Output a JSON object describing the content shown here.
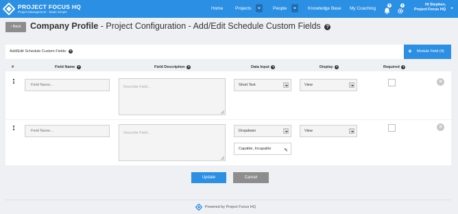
{
  "brand": {
    "name": "PROJECT FOCUS HQ",
    "tagline": "Project Management - Made Simple",
    "accent": "#2b8fe3"
  },
  "nav": {
    "home": "Home",
    "projects": "Projects",
    "people": "People",
    "knowledge_base": "Knowledge Base",
    "my_coaching": "My Coaching",
    "notifications_count": "2",
    "settings_count": "1",
    "user_greeting": "Hi Stephen,",
    "user_company": "Project Focus HQ"
  },
  "page": {
    "back_label": "Back",
    "title_bold": "Company Profile",
    "title_rest": " - Project Configuration - Add/Edit Schedule Custom Fields",
    "help_glyph": "?"
  },
  "panel": {
    "label": "Add/Edit Schedule Custom Fields:",
    "module_field_button": "Module Field (4)"
  },
  "columns": {
    "hash": "#",
    "field_name": "Field Name",
    "field_description": "Field Description",
    "data_input": "Data Input",
    "display": "Display",
    "required": "Required"
  },
  "rows": [
    {
      "name_placeholder": "Field Name...",
      "desc_placeholder": "Describe Field...",
      "data_input": "Short Text",
      "display": "View",
      "required": false
    },
    {
      "name_placeholder": "Field Name...",
      "desc_placeholder": "Describe Field...",
      "data_input": "Dropdown",
      "options": "Capable, Incapable",
      "display": "View",
      "required": false
    }
  ],
  "actions": {
    "update": "Update",
    "cancel": "Cancel"
  },
  "footer": {
    "text": "Powered by Project Focus HQ"
  }
}
